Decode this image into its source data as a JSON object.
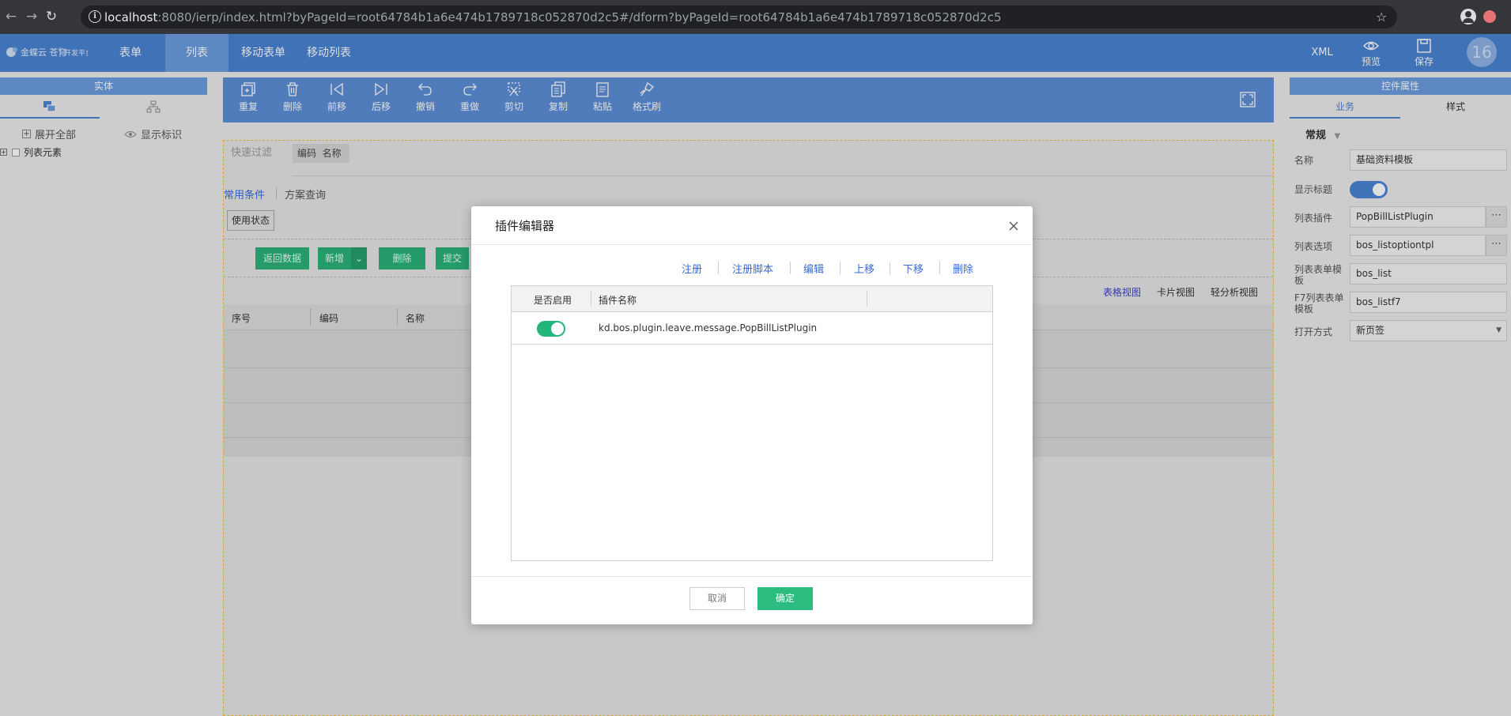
{
  "browser": {
    "url_host": "localhost",
    "url_rest": ":8080/ierp/index.html?byPageId=root64784b1a6e474b1789718c052870d2c5#/dform?byPageId=root64784b1a6e474b1789718c052870d2c5"
  },
  "topnav": {
    "tabs": [
      {
        "label": "表单"
      },
      {
        "label": "列表"
      },
      {
        "label": "移动表单"
      },
      {
        "label": "移动列表"
      }
    ],
    "xml_label": "XML",
    "preview_label": "预览",
    "save_label": "保存",
    "avatar_text": "16"
  },
  "left_panel": {
    "header": "实体",
    "expand_all": "展开全部",
    "show_ids": "显示标识",
    "tree_root": "列表元素"
  },
  "toolbar": {
    "buttons": [
      {
        "label": "重复",
        "icon": "duplicate-icon"
      },
      {
        "label": "删除",
        "icon": "trash-icon"
      },
      {
        "label": "前移",
        "icon": "move-prev-icon"
      },
      {
        "label": "后移",
        "icon": "move-next-icon"
      },
      {
        "label": "撤销",
        "icon": "undo-icon"
      },
      {
        "label": "重做",
        "icon": "redo-icon"
      },
      {
        "label": "剪切",
        "icon": "cut-icon"
      },
      {
        "label": "复制",
        "icon": "copy-icon"
      },
      {
        "label": "粘贴",
        "icon": "paste-icon"
      },
      {
        "label": "格式刷",
        "icon": "format-brush-icon"
      }
    ]
  },
  "canvas": {
    "quick_filter": "快速过滤",
    "filter_fields": "编码  名称",
    "common_conditions": "常用条件",
    "scheme_query": "方案查询",
    "use_status": "使用状态",
    "buttons": {
      "return_data": "返回数据",
      "add_new": "新增",
      "delete": "删除",
      "submit": "提交"
    },
    "views": {
      "table": "表格视图",
      "card": "卡片视图",
      "analysis": "轻分析视图"
    },
    "columns": [
      "序号",
      "编码",
      "名称"
    ]
  },
  "right_panel": {
    "header": "控件属性",
    "tabs": [
      "业务",
      "样式"
    ],
    "section": "常规",
    "props": {
      "name_label": "名称",
      "name_value": "基础资料模板",
      "show_title_label": "显示标题",
      "list_plugin_label": "列表插件",
      "list_plugin_value": "PopBillListPlugin",
      "list_option_label": "列表选项",
      "list_option_value": "bos_listoptiontpl",
      "list_form_tpl_label": "列表表单模板",
      "list_form_tpl_value": "bos_list",
      "f7_tpl_label": "F7列表表单模板",
      "f7_tpl_value": "bos_listf7",
      "open_mode_label": "打开方式",
      "open_mode_value": "新页签"
    },
    "show_title_on": true
  },
  "modal": {
    "title": "插件编辑器",
    "actions": [
      "注册",
      "注册脚本",
      "编辑",
      "上移",
      "下移",
      "删除"
    ],
    "columns": [
      "是否启用",
      "插件名称"
    ],
    "rows": [
      {
        "enabled": true,
        "name": "kd.bos.plugin.leave.message.PopBillListPlugin"
      }
    ],
    "cancel_label": "取消",
    "ok_label": "确定"
  },
  "colors": {
    "topnav": "#4a83d4",
    "accent_green": "#2bbd80",
    "link_blue": "#3b6ad6"
  }
}
